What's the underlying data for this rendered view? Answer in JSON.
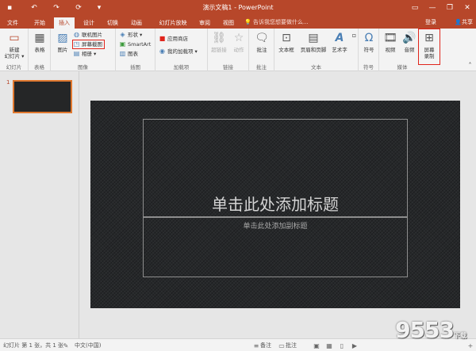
{
  "window": {
    "title": "演示文稿1 - PowerPoint"
  },
  "tabs": [
    "文件",
    "开始",
    "插入",
    "设计",
    "切换",
    "动画",
    "幻灯片放映",
    "审阅",
    "视图"
  ],
  "tellme": "告诉我您想要做什么...",
  "account": {
    "login": "登录",
    "share": "共享"
  },
  "ribbon": {
    "groups": {
      "slides": "幻灯片",
      "tables": "表格",
      "images": "图像",
      "illustrations": "插图",
      "addins": "加载项",
      "links": "链接",
      "comments": "批注",
      "text": "文本",
      "symbols": "符号",
      "media": "媒体"
    },
    "buttons": {
      "new_slide": "新建\n幻灯片 ▾",
      "table": "表格",
      "pictures": "图片",
      "online_pictures": "联机图片",
      "screenshot": "屏幕截图",
      "album": "相册",
      "shapes": "形状",
      "smartart": "SmartArt",
      "chart": "图表",
      "store": "应用商店",
      "my_addins": "我的加载项",
      "hyperlink": "超链接",
      "action": "动作",
      "comment": "批注",
      "textbox": "文本框",
      "header_footer": "页眉和页脚",
      "wordart": "艺术字",
      "symbol": "符号",
      "video": "视频",
      "audio": "音频",
      "screen_recording": "屏幕\n录制"
    }
  },
  "slide_pane": {
    "number": "1"
  },
  "slide": {
    "title_placeholder": "单击此处添加标题",
    "subtitle_placeholder": "单击此处添加副标题"
  },
  "status": {
    "slide_info": "幻灯片 第 1 张，共 1 张",
    "language": "中文(中国)",
    "notes": "备注",
    "comments": "批注",
    "zoom": "+"
  },
  "watermark": {
    "brand": "9553",
    "suffix": "下载"
  },
  "colors": {
    "accent": "#b7472a",
    "highlight": "#e0241b",
    "slide_bg": "#26282a"
  }
}
